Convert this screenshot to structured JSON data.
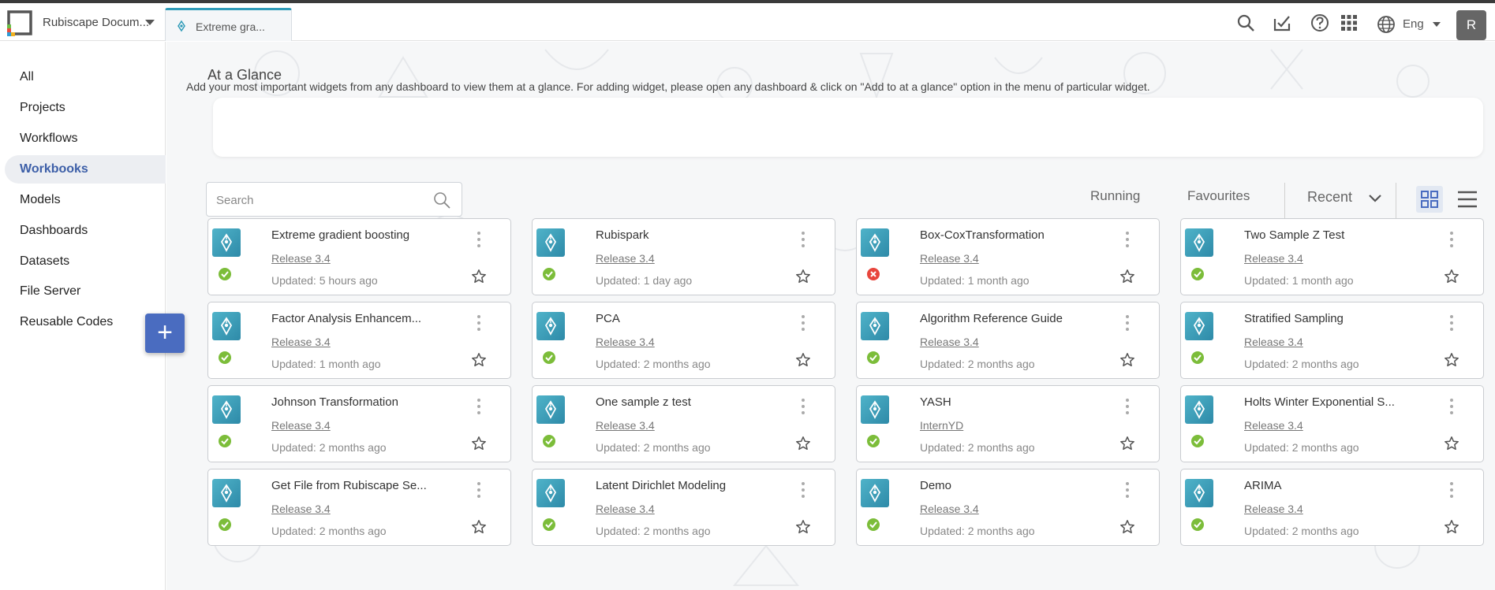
{
  "header": {
    "workspace": "Rubiscape Docum...",
    "tab_label": "Extreme gra...",
    "language": "Eng",
    "avatar_letter": "R"
  },
  "sidebar": {
    "items": [
      {
        "label": "All",
        "active": false
      },
      {
        "label": "Projects",
        "active": false
      },
      {
        "label": "Workflows",
        "active": false
      },
      {
        "label": "Workbooks",
        "active": true
      },
      {
        "label": "Models",
        "active": false
      },
      {
        "label": "Dashboards",
        "active": false
      },
      {
        "label": "Datasets",
        "active": false
      },
      {
        "label": "File Server",
        "active": false
      },
      {
        "label": "Reusable Codes",
        "active": false
      }
    ],
    "fab_label": "+"
  },
  "glance": {
    "title": "At a Glance",
    "text": "Add your most important widgets from any dashboard to view them at a glance. For adding widget, please open any dashboard & click on \"Add to at a glance\" option in the menu of particular widget."
  },
  "search": {
    "placeholder": "Search"
  },
  "filters": {
    "running": "Running",
    "favourites": "Favourites",
    "sort": "Recent"
  },
  "colors": {
    "accent": "#3d5fa8",
    "tab_accent": "#2f9bb8",
    "ok": "#7cbd3a",
    "error": "#e8453c"
  },
  "cards": [
    {
      "title": "Extreme gradient boosting",
      "tag": "Release 3.4",
      "updated": "Updated: 5 hours ago",
      "status": "ok"
    },
    {
      "title": "Rubispark",
      "tag": "Release 3.4",
      "updated": "Updated: 1 day ago",
      "status": "ok"
    },
    {
      "title": "Box-CoxTransformation",
      "tag": "Release 3.4",
      "updated": "Updated: 1 month ago",
      "status": "error"
    },
    {
      "title": "Two Sample Z Test",
      "tag": "Release 3.4",
      "updated": "Updated: 1 month ago",
      "status": "ok"
    },
    {
      "title": "Factor Analysis Enhancem...",
      "tag": "Release 3.4",
      "updated": "Updated: 1 month ago",
      "status": "ok"
    },
    {
      "title": "PCA",
      "tag": "Release 3.4",
      "updated": "Updated: 2 months ago",
      "status": "ok"
    },
    {
      "title": "Algorithm Reference Guide",
      "tag": "Release 3.4",
      "updated": "Updated: 2 months ago",
      "status": "ok"
    },
    {
      "title": "Stratified Sampling",
      "tag": "Release 3.4",
      "updated": "Updated: 2 months ago",
      "status": "ok"
    },
    {
      "title": "Johnson Transformation",
      "tag": "Release 3.4",
      "updated": "Updated: 2 months ago",
      "status": "ok"
    },
    {
      "title": "One sample z test",
      "tag": "Release 3.4",
      "updated": "Updated: 2 months ago",
      "status": "ok"
    },
    {
      "title": "YASH",
      "tag": "InternYD",
      "updated": "Updated: 2 months ago",
      "status": "ok"
    },
    {
      "title": "Holts Winter Exponential S...",
      "tag": "Release 3.4",
      "updated": "Updated: 2 months ago",
      "status": "ok"
    },
    {
      "title": "Get File from Rubiscape Se...",
      "tag": "Release 3.4",
      "updated": "Updated: 2 months ago",
      "status": "ok"
    },
    {
      "title": "Latent Dirichlet Modeling",
      "tag": "Release 3.4",
      "updated": "Updated: 2 months ago",
      "status": "ok"
    },
    {
      "title": "Demo",
      "tag": "Release 3.4",
      "updated": "Updated: 2 months ago",
      "status": "ok"
    },
    {
      "title": "ARIMA",
      "tag": "Release 3.4",
      "updated": "Updated: 2 months ago",
      "status": "ok"
    }
  ]
}
